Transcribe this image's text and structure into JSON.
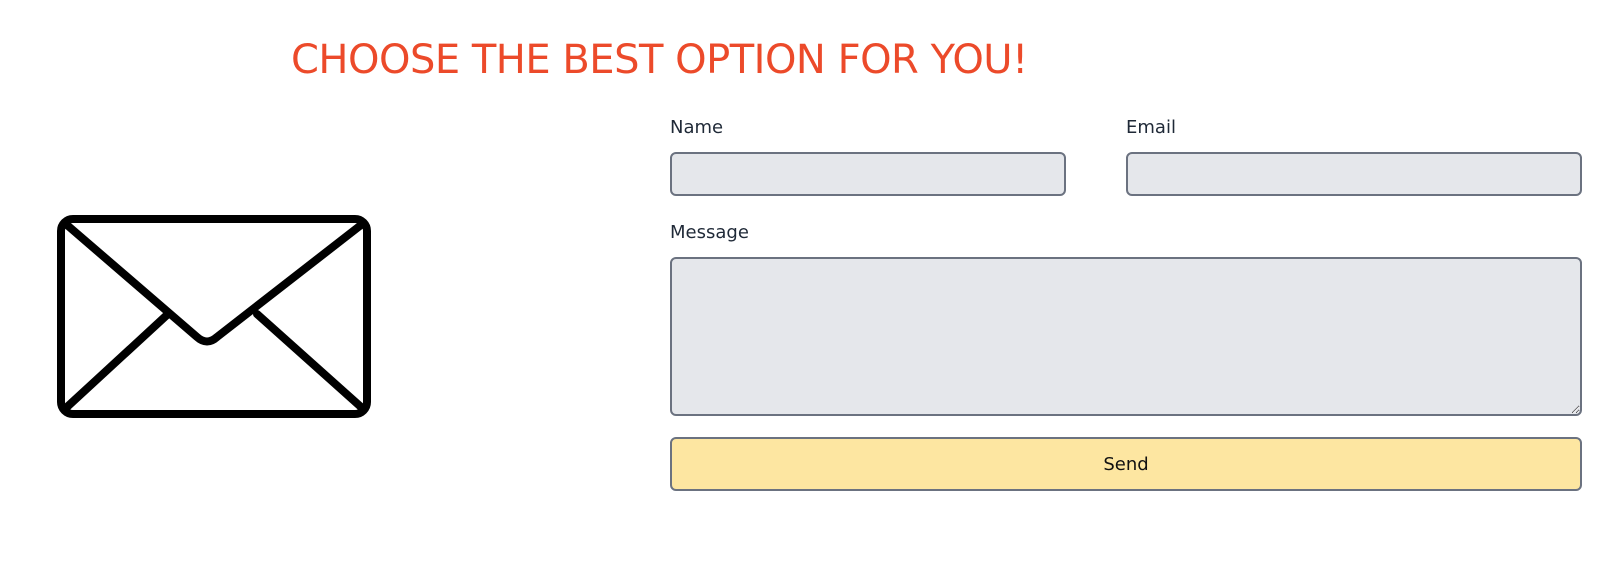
{
  "header": {
    "headline": "CHOOSE THE BEST OPTION FOR YOU!",
    "headline_color": "#ec4a2a"
  },
  "illustration": {
    "icon": "envelope-icon"
  },
  "form": {
    "name": {
      "label": "Name",
      "value": "",
      "placeholder": ""
    },
    "email": {
      "label": "Email",
      "value": "",
      "placeholder": ""
    },
    "message": {
      "label": "Message",
      "value": "",
      "placeholder": ""
    },
    "submit": {
      "label": "Send",
      "color": "#fde6a1"
    }
  }
}
